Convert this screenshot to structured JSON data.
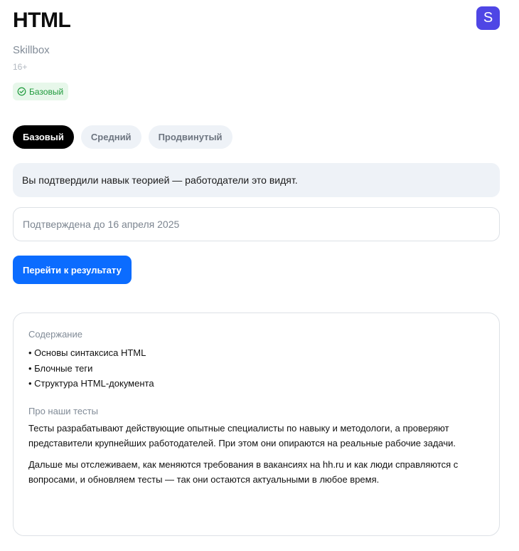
{
  "skill": {
    "title": "HTML",
    "provider": "Skillbox",
    "provider_logo_letter": "S",
    "age_rating": "16+",
    "level_badge": "Базовый",
    "level_badge_icon": "check-circle-icon"
  },
  "tabs": [
    {
      "label": "Базовый",
      "active": true
    },
    {
      "label": "Средний",
      "active": false
    },
    {
      "label": "Продвинутый",
      "active": false
    }
  ],
  "info_message": "Вы подтвердили навык теорией — работодатели это видят.",
  "validity_text": "Подтверждена до 16 апреля 2025",
  "result_button_label": "Перейти к результату",
  "content_section": {
    "heading": "Содержание",
    "items": [
      "Основы синтаксиса HTML",
      "Блочные теги",
      "Структура HTML-документа"
    ]
  },
  "about_section": {
    "heading": "Про наши тесты",
    "paragraphs": [
      "Тесты разрабатывают действующие опытные специалисты по навыку и методологи, а проверяют представители крупнейших работодателей. При этом они опираются на реальные рабочие задачи.",
      "Дальше мы отслеживаем, как меняются требования в вакансиях на hh.ru и как люди справляются с вопросами, и обновляем тесты — так они остаются актуальными в любое время."
    ]
  },
  "colors": {
    "accent": "#0b6cff",
    "provider_logo": "#4f46e5",
    "badge_bg": "#e7f7ea",
    "badge_text": "#1f9a3c",
    "tab_active": "#000000",
    "tab_inactive_bg": "#eef2f7"
  }
}
